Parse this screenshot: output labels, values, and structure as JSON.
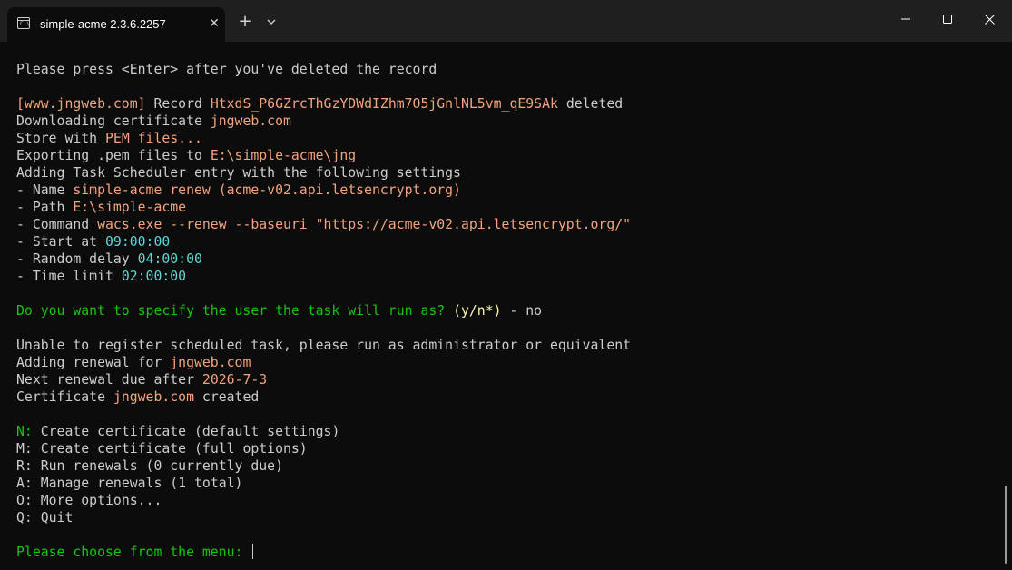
{
  "window": {
    "tab_title": "simple-acme 2.3.6.2257",
    "tab_icon": "terminal-icon",
    "tab_close": "✕",
    "new_tab": "+",
    "icons": [
      "terminal-icon",
      "close-icon",
      "plus-icon",
      "chevron-down-icon",
      "minimize-icon",
      "maximize-icon",
      "close-icon"
    ]
  },
  "colors": {
    "background": "#0c0c0c",
    "titlebar": "#1f1f1f",
    "text": "#cccccc",
    "highlight": "#f3a47e",
    "prompt": "#16c60c",
    "time": "#61d6d6",
    "option": "#f9f1a5"
  },
  "terminal": {
    "l1": "Please press <Enter> after you've deleted the record",
    "l3": {
      "domain": "[www.jngweb.com]",
      "t1": " Record ",
      "record": "HtxdS_P6GZrcThGzYDWdIZhm7O5jGnlNL5vm_qE9SAk",
      "t2": " deleted"
    },
    "l4": {
      "t1": "Downloading certificate ",
      "v": "jngweb.com"
    },
    "l5": {
      "t1": "Store with ",
      "v": "PEM files..."
    },
    "l6": {
      "t1": "Exporting .pem files to ",
      "v": "E:\\simple-acme\\jng"
    },
    "l7": "Adding Task Scheduler entry with the following settings",
    "l8": {
      "t1": "- Name ",
      "v": "simple-acme renew (acme-v02.api.letsencrypt.org)"
    },
    "l9": {
      "t1": "- Path ",
      "v": "E:\\simple-acme"
    },
    "l10": {
      "t1": "- Command ",
      "v": "wacs.exe --renew --baseuri \"https://acme-v02.api.letsencrypt.org/\""
    },
    "l11": {
      "t1": "- Start at ",
      "v": "09:00:00"
    },
    "l12": {
      "t1": "- Random delay ",
      "v": "04:00:00"
    },
    "l13": {
      "t1": "- Time limit ",
      "v": "02:00:00"
    },
    "l15": {
      "q": "Do you want to specify the user the task will run as? ",
      "opt": "(y/n*)",
      "ans": " - no"
    },
    "l17": "Unable to register scheduled task, please run as administrator or equivalent",
    "l18": {
      "t1": "Adding renewal for ",
      "v": "jngweb.com"
    },
    "l19": {
      "t1": "Next renewal due after ",
      "v": "2026-7-3"
    },
    "l20": {
      "t1": "Certificate ",
      "v": "jngweb.com",
      "t2": " created"
    },
    "menu": [
      {
        "key": "N:",
        "label": " Create certificate (default settings)"
      },
      {
        "key": "M:",
        "label": " Create certificate (full options)"
      },
      {
        "key": "R:",
        "label": " Run renewals (0 currently due)"
      },
      {
        "key": "A:",
        "label": " Manage renewals (1 total)"
      },
      {
        "key": "O:",
        "label": " More options..."
      },
      {
        "key": "Q:",
        "label": " Quit"
      }
    ],
    "prompt": "Please choose from the menu: "
  }
}
